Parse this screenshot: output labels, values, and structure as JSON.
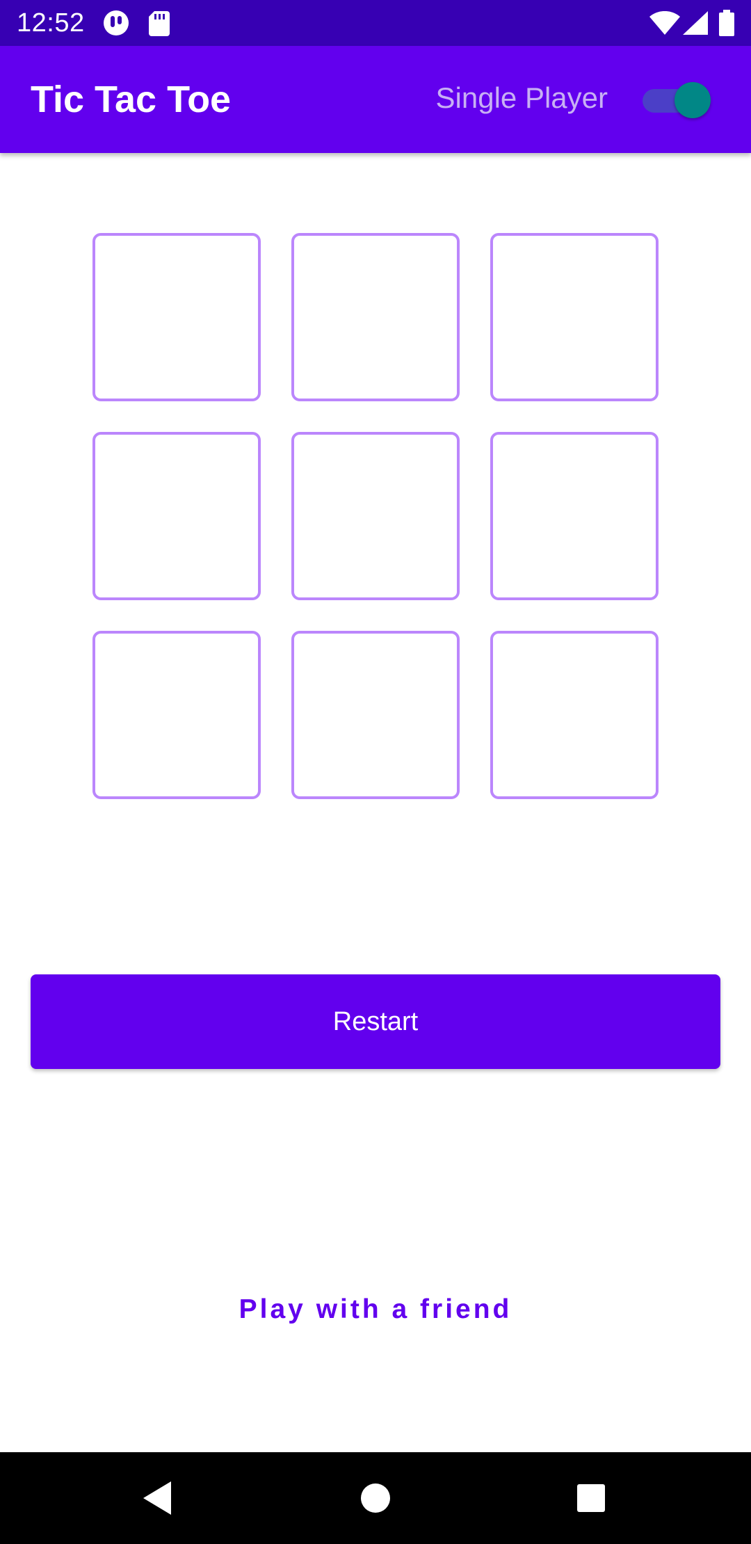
{
  "status_bar": {
    "time": "12:52",
    "icons": [
      "notification-app-icon",
      "sd-card-icon",
      "wifi-icon",
      "cellular-signal-icon",
      "battery-icon"
    ]
  },
  "app_bar": {
    "title": "Tic Tac Toe",
    "mode_label": "Single Player",
    "single_player_enabled": true
  },
  "board": {
    "cells": [
      "",
      "",
      "",
      "",
      "",
      "",
      "",
      "",
      ""
    ]
  },
  "actions": {
    "restart_label": "Restart",
    "toggle_mode_label": "Play with a friend"
  },
  "nav_bar": {
    "icons": [
      "back-icon",
      "home-icon",
      "recents-icon"
    ]
  },
  "colors": {
    "status_bar": "#3700B3",
    "primary": "#6200EE",
    "cell_border": "#BB86FC",
    "switch_thumb": "#018786",
    "switch_track": "#4B3FC7",
    "mode_label": "#C8B0F4"
  }
}
